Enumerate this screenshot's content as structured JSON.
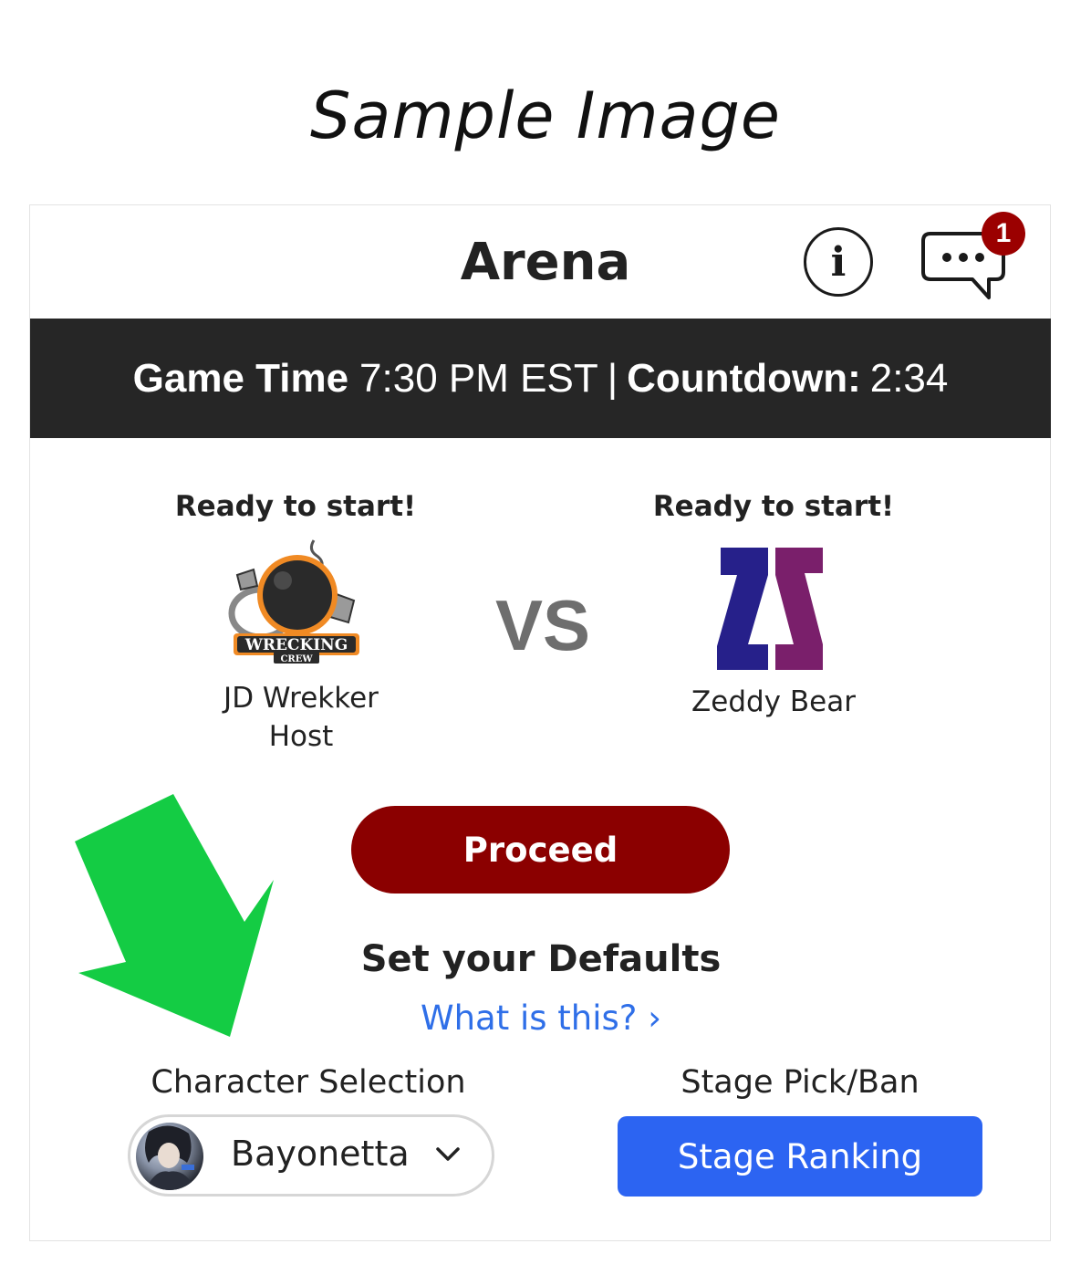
{
  "watermark": "Sample Image",
  "header": {
    "title": "Arena",
    "info_icon": "info-icon",
    "chat_icon": "chat-bubble-icon",
    "chat_badge": "1"
  },
  "banner": {
    "game_time_label": "Game Time",
    "game_time_value": "7:30 PM EST",
    "separator": "|",
    "countdown_label": "Countdown:",
    "countdown_value": "2:34"
  },
  "match": {
    "left": {
      "status": "Ready to start!",
      "name": "JD Wrekker",
      "role": "Host",
      "logo_text": "WRECKING",
      "logo_subtext": "CREW"
    },
    "vs": "VS",
    "right": {
      "status": "Ready to start!",
      "name": "Zeddy Bear"
    }
  },
  "proceed_label": "Proceed",
  "defaults": {
    "title": "Set your Defaults",
    "help_link": "What is this? ›"
  },
  "character": {
    "label": "Character Selection",
    "selected": "Bayonetta"
  },
  "stage": {
    "label": "Stage Pick/Ban",
    "button": "Stage Ranking"
  },
  "colors": {
    "banner": "#262626",
    "proceed": "#8b0000",
    "link": "#2f6fe8",
    "stage_button": "#2c64f2",
    "arrow": "#14cc44",
    "badge": "#9b0000"
  }
}
